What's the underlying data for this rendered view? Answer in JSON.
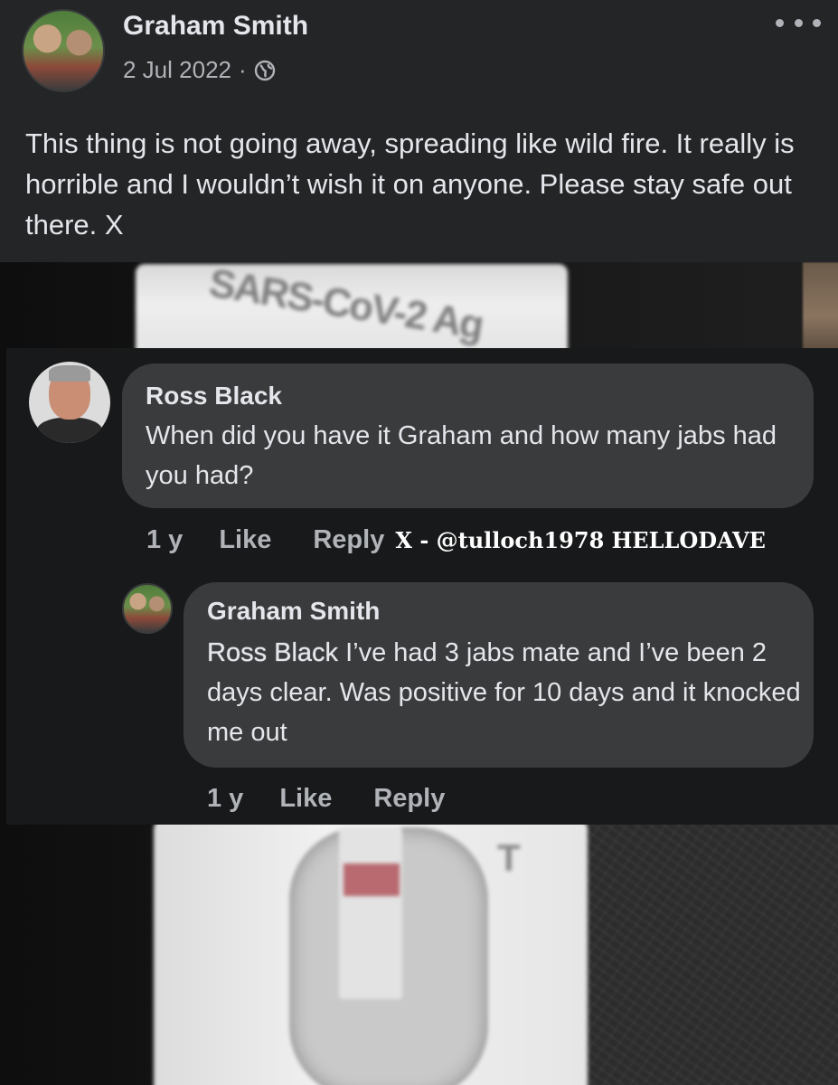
{
  "post": {
    "author": "Graham Smith",
    "date": "2 Jul 2022",
    "separator": "·",
    "visibility_icon": "globe-icon",
    "more_icon": "more-options-icon",
    "text": "This thing is not going away, spreading like wild fire. It really is horrible and I wouldn’t wish it on anyone. Please stay safe out there. X"
  },
  "photo": {
    "kit_label": "SARS-CoV-2 Ag",
    "test_marker": "T"
  },
  "comments": [
    {
      "author": "Ross Black",
      "text": "When did you have it Graham and how many jabs had you had?",
      "time": "1 y",
      "like_label": "Like",
      "reply_label": "Reply",
      "watermark": "X - @tulloch1978 HELLODAVE"
    },
    {
      "author": "Graham Smith",
      "mention": "Ross Black",
      "text": " I’ve had 3 jabs mate and I’ve been 2 days clear. Was positive for 10 days and it knocked me out",
      "time": "1 y",
      "like_label": "Like",
      "reply_label": "Reply"
    }
  ],
  "colors": {
    "post_bg": "#242526",
    "comments_bg": "#18191a",
    "bubble_bg": "#3a3b3c",
    "primary_text": "#e4e6eb",
    "secondary_text": "#b0b3b8"
  }
}
